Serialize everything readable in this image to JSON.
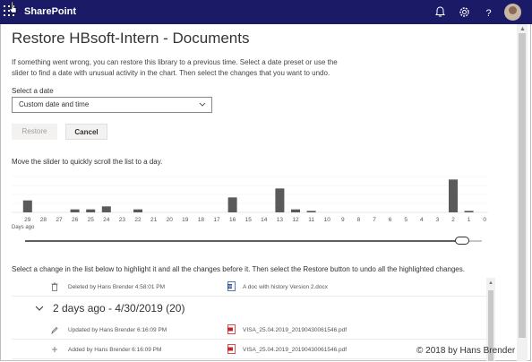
{
  "header": {
    "brand": "SharePoint",
    "icons": [
      "waffle-icon",
      "bell-icon",
      "gear-icon",
      "help-icon",
      "avatar"
    ]
  },
  "page": {
    "title": "Restore HBsoft-Intern - Documents",
    "description": "If something went wrong, you can restore this library to a previous time. Select a date preset or use the slider to find a date with unusual activity in the chart. Then select the changes that you want to undo.",
    "select_label": "Select a date",
    "select_value": "Custom date and time",
    "restore_label": "Restore",
    "cancel_label": "Cancel",
    "slider_instruction": "Move the slider to quickly scroll the list to a day.",
    "days_ago_label": "Days ago",
    "list_instruction": "Select a change in the list below to highlight it and all the changes before it. Then select the Restore button to undo all the highlighted changes."
  },
  "chart_data": {
    "type": "bar",
    "categories": [
      "29",
      "28",
      "27",
      "26",
      "25",
      "24",
      "23",
      "22",
      "21",
      "20",
      "19",
      "18",
      "17",
      "16",
      "15",
      "14",
      "13",
      "12",
      "11",
      "10",
      "9",
      "8",
      "7",
      "6",
      "5",
      "4",
      "3",
      "2",
      "1",
      "0"
    ],
    "values": [
      4,
      0,
      0,
      1,
      1,
      2,
      0,
      1,
      0,
      0,
      0,
      0,
      0,
      5,
      0,
      0,
      8,
      1,
      0.5,
      0,
      0,
      0,
      0,
      0,
      0,
      0,
      0,
      11,
      0.5,
      0
    ],
    "xlabel": "Days ago",
    "ylim": [
      0,
      12
    ],
    "slider_position_days_ago": 1
  },
  "changes": {
    "first_row": {
      "who": "Deleted by Hans Brender 4:58:01 PM",
      "file": "A doc with history Version 2.docx"
    },
    "group_title": "2 days ago - 4/30/2019 (20)",
    "rows": [
      {
        "who": "Updated by Hans Brender 6:16:09 PM",
        "file": "VISA_25.04.2019_20190430061546.pdf"
      },
      {
        "who": "Added by Hans Brender 6:16:09 PM",
        "file": "VISA_25.04.2019_20190430061546.pdf"
      }
    ]
  },
  "watermark": "© 2018 by Hans Brender",
  "colors": {
    "suitebar": "#1a1a66",
    "bar": "#5a5a5a",
    "pdf": "#c7252a",
    "word": "#2b579a"
  }
}
